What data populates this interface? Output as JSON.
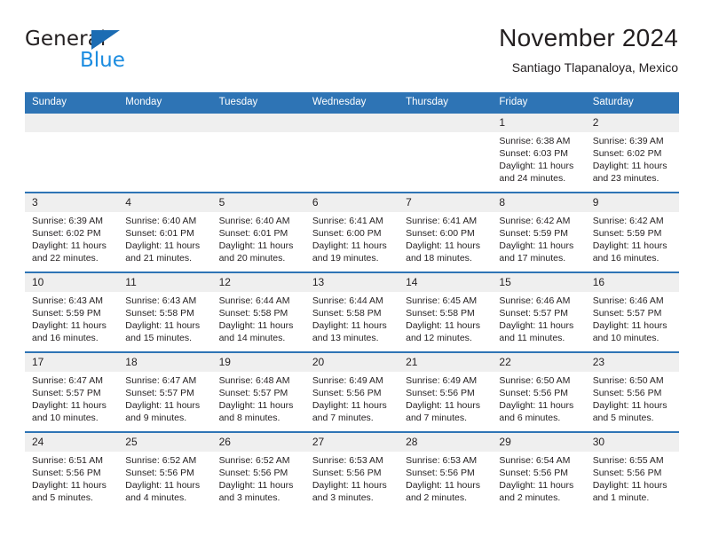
{
  "brand": {
    "name_top": "General",
    "name_bottom": "Blue",
    "triangle_color": "#1b6cb3",
    "blue_text_color": "#1b8ce0"
  },
  "header": {
    "title": "November 2024",
    "subtitle": "Santiago Tlapanaloya, Mexico"
  },
  "colors": {
    "header_blue": "#2e74b5",
    "daynum_band": "#efefef",
    "text": "#231f20"
  },
  "calendar": {
    "weekday_headers": [
      "Sunday",
      "Monday",
      "Tuesday",
      "Wednesday",
      "Thursday",
      "Friday",
      "Saturday"
    ],
    "labels": {
      "sunrise": "Sunrise:",
      "sunset": "Sunset:",
      "daylight": "Daylight:"
    },
    "weeks": [
      [
        {
          "day": "",
          "empty": true,
          "sunrise": "",
          "sunset": "",
          "daylight_line1": "",
          "daylight_line2": ""
        },
        {
          "day": "",
          "empty": true,
          "sunrise": "",
          "sunset": "",
          "daylight_line1": "",
          "daylight_line2": ""
        },
        {
          "day": "",
          "empty": true,
          "sunrise": "",
          "sunset": "",
          "daylight_line1": "",
          "daylight_line2": ""
        },
        {
          "day": "",
          "empty": true,
          "sunrise": "",
          "sunset": "",
          "daylight_line1": "",
          "daylight_line2": ""
        },
        {
          "day": "",
          "empty": true,
          "sunrise": "",
          "sunset": "",
          "daylight_line1": "",
          "daylight_line2": ""
        },
        {
          "day": "1",
          "empty": false,
          "sunrise": "Sunrise: 6:38 AM",
          "sunset": "Sunset: 6:03 PM",
          "daylight_line1": "Daylight: 11 hours",
          "daylight_line2": "and 24 minutes."
        },
        {
          "day": "2",
          "empty": false,
          "sunrise": "Sunrise: 6:39 AM",
          "sunset": "Sunset: 6:02 PM",
          "daylight_line1": "Daylight: 11 hours",
          "daylight_line2": "and 23 minutes."
        }
      ],
      [
        {
          "day": "3",
          "empty": false,
          "sunrise": "Sunrise: 6:39 AM",
          "sunset": "Sunset: 6:02 PM",
          "daylight_line1": "Daylight: 11 hours",
          "daylight_line2": "and 22 minutes."
        },
        {
          "day": "4",
          "empty": false,
          "sunrise": "Sunrise: 6:40 AM",
          "sunset": "Sunset: 6:01 PM",
          "daylight_line1": "Daylight: 11 hours",
          "daylight_line2": "and 21 minutes."
        },
        {
          "day": "5",
          "empty": false,
          "sunrise": "Sunrise: 6:40 AM",
          "sunset": "Sunset: 6:01 PM",
          "daylight_line1": "Daylight: 11 hours",
          "daylight_line2": "and 20 minutes."
        },
        {
          "day": "6",
          "empty": false,
          "sunrise": "Sunrise: 6:41 AM",
          "sunset": "Sunset: 6:00 PM",
          "daylight_line1": "Daylight: 11 hours",
          "daylight_line2": "and 19 minutes."
        },
        {
          "day": "7",
          "empty": false,
          "sunrise": "Sunrise: 6:41 AM",
          "sunset": "Sunset: 6:00 PM",
          "daylight_line1": "Daylight: 11 hours",
          "daylight_line2": "and 18 minutes."
        },
        {
          "day": "8",
          "empty": false,
          "sunrise": "Sunrise: 6:42 AM",
          "sunset": "Sunset: 5:59 PM",
          "daylight_line1": "Daylight: 11 hours",
          "daylight_line2": "and 17 minutes."
        },
        {
          "day": "9",
          "empty": false,
          "sunrise": "Sunrise: 6:42 AM",
          "sunset": "Sunset: 5:59 PM",
          "daylight_line1": "Daylight: 11 hours",
          "daylight_line2": "and 16 minutes."
        }
      ],
      [
        {
          "day": "10",
          "empty": false,
          "sunrise": "Sunrise: 6:43 AM",
          "sunset": "Sunset: 5:59 PM",
          "daylight_line1": "Daylight: 11 hours",
          "daylight_line2": "and 16 minutes."
        },
        {
          "day": "11",
          "empty": false,
          "sunrise": "Sunrise: 6:43 AM",
          "sunset": "Sunset: 5:58 PM",
          "daylight_line1": "Daylight: 11 hours",
          "daylight_line2": "and 15 minutes."
        },
        {
          "day": "12",
          "empty": false,
          "sunrise": "Sunrise: 6:44 AM",
          "sunset": "Sunset: 5:58 PM",
          "daylight_line1": "Daylight: 11 hours",
          "daylight_line2": "and 14 minutes."
        },
        {
          "day": "13",
          "empty": false,
          "sunrise": "Sunrise: 6:44 AM",
          "sunset": "Sunset: 5:58 PM",
          "daylight_line1": "Daylight: 11 hours",
          "daylight_line2": "and 13 minutes."
        },
        {
          "day": "14",
          "empty": false,
          "sunrise": "Sunrise: 6:45 AM",
          "sunset": "Sunset: 5:58 PM",
          "daylight_line1": "Daylight: 11 hours",
          "daylight_line2": "and 12 minutes."
        },
        {
          "day": "15",
          "empty": false,
          "sunrise": "Sunrise: 6:46 AM",
          "sunset": "Sunset: 5:57 PM",
          "daylight_line1": "Daylight: 11 hours",
          "daylight_line2": "and 11 minutes."
        },
        {
          "day": "16",
          "empty": false,
          "sunrise": "Sunrise: 6:46 AM",
          "sunset": "Sunset: 5:57 PM",
          "daylight_line1": "Daylight: 11 hours",
          "daylight_line2": "and 10 minutes."
        }
      ],
      [
        {
          "day": "17",
          "empty": false,
          "sunrise": "Sunrise: 6:47 AM",
          "sunset": "Sunset: 5:57 PM",
          "daylight_line1": "Daylight: 11 hours",
          "daylight_line2": "and 10 minutes."
        },
        {
          "day": "18",
          "empty": false,
          "sunrise": "Sunrise: 6:47 AM",
          "sunset": "Sunset: 5:57 PM",
          "daylight_line1": "Daylight: 11 hours",
          "daylight_line2": "and 9 minutes."
        },
        {
          "day": "19",
          "empty": false,
          "sunrise": "Sunrise: 6:48 AM",
          "sunset": "Sunset: 5:57 PM",
          "daylight_line1": "Daylight: 11 hours",
          "daylight_line2": "and 8 minutes."
        },
        {
          "day": "20",
          "empty": false,
          "sunrise": "Sunrise: 6:49 AM",
          "sunset": "Sunset: 5:56 PM",
          "daylight_line1": "Daylight: 11 hours",
          "daylight_line2": "and 7 minutes."
        },
        {
          "day": "21",
          "empty": false,
          "sunrise": "Sunrise: 6:49 AM",
          "sunset": "Sunset: 5:56 PM",
          "daylight_line1": "Daylight: 11 hours",
          "daylight_line2": "and 7 minutes."
        },
        {
          "day": "22",
          "empty": false,
          "sunrise": "Sunrise: 6:50 AM",
          "sunset": "Sunset: 5:56 PM",
          "daylight_line1": "Daylight: 11 hours",
          "daylight_line2": "and 6 minutes."
        },
        {
          "day": "23",
          "empty": false,
          "sunrise": "Sunrise: 6:50 AM",
          "sunset": "Sunset: 5:56 PM",
          "daylight_line1": "Daylight: 11 hours",
          "daylight_line2": "and 5 minutes."
        }
      ],
      [
        {
          "day": "24",
          "empty": false,
          "sunrise": "Sunrise: 6:51 AM",
          "sunset": "Sunset: 5:56 PM",
          "daylight_line1": "Daylight: 11 hours",
          "daylight_line2": "and 5 minutes."
        },
        {
          "day": "25",
          "empty": false,
          "sunrise": "Sunrise: 6:52 AM",
          "sunset": "Sunset: 5:56 PM",
          "daylight_line1": "Daylight: 11 hours",
          "daylight_line2": "and 4 minutes."
        },
        {
          "day": "26",
          "empty": false,
          "sunrise": "Sunrise: 6:52 AM",
          "sunset": "Sunset: 5:56 PM",
          "daylight_line1": "Daylight: 11 hours",
          "daylight_line2": "and 3 minutes."
        },
        {
          "day": "27",
          "empty": false,
          "sunrise": "Sunrise: 6:53 AM",
          "sunset": "Sunset: 5:56 PM",
          "daylight_line1": "Daylight: 11 hours",
          "daylight_line2": "and 3 minutes."
        },
        {
          "day": "28",
          "empty": false,
          "sunrise": "Sunrise: 6:53 AM",
          "sunset": "Sunset: 5:56 PM",
          "daylight_line1": "Daylight: 11 hours",
          "daylight_line2": "and 2 minutes."
        },
        {
          "day": "29",
          "empty": false,
          "sunrise": "Sunrise: 6:54 AM",
          "sunset": "Sunset: 5:56 PM",
          "daylight_line1": "Daylight: 11 hours",
          "daylight_line2": "and 2 minutes."
        },
        {
          "day": "30",
          "empty": false,
          "sunrise": "Sunrise: 6:55 AM",
          "sunset": "Sunset: 5:56 PM",
          "daylight_line1": "Daylight: 11 hours",
          "daylight_line2": "and 1 minute."
        }
      ]
    ]
  }
}
